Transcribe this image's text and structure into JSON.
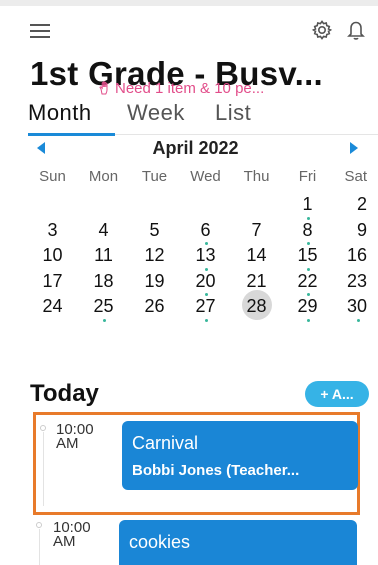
{
  "header": {
    "menu_icon": "hamburger-icon",
    "settings_icon": "gear-icon",
    "notifications_icon": "bell-icon",
    "title": "1st Grade - Busv..."
  },
  "tabs": [
    {
      "label": "Month",
      "active": true
    },
    {
      "label": "Week",
      "active": false
    },
    {
      "label": "List",
      "active": false
    }
  ],
  "calendar": {
    "month_label": "April 2022",
    "weekdays": [
      "Sun",
      "Mon",
      "Tue",
      "Wed",
      "Thu",
      "Fri",
      "Sat"
    ],
    "weeks": [
      [
        {
          "d": "",
          "dot": false
        },
        {
          "d": "",
          "dot": false
        },
        {
          "d": "",
          "dot": false
        },
        {
          "d": "",
          "dot": false
        },
        {
          "d": "",
          "dot": false
        },
        {
          "d": "1",
          "dot": true
        },
        {
          "d": "2",
          "dot": false
        }
      ],
      [
        {
          "d": "3",
          "dot": false
        },
        {
          "d": "4",
          "dot": false
        },
        {
          "d": "5",
          "dot": false
        },
        {
          "d": "6",
          "dot": true
        },
        {
          "d": "7",
          "dot": false
        },
        {
          "d": "8",
          "dot": true
        },
        {
          "d": "9",
          "dot": false
        }
      ],
      [
        {
          "d": "10",
          "dot": false
        },
        {
          "d": "11",
          "dot": false
        },
        {
          "d": "12",
          "dot": false
        },
        {
          "d": "13",
          "dot": true
        },
        {
          "d": "14",
          "dot": false
        },
        {
          "d": "15",
          "dot": true
        },
        {
          "d": "16",
          "dot": false
        }
      ],
      [
        {
          "d": "17",
          "dot": false
        },
        {
          "d": "18",
          "dot": false
        },
        {
          "d": "19",
          "dot": false
        },
        {
          "d": "20",
          "dot": true
        },
        {
          "d": "21",
          "dot": false
        },
        {
          "d": "22",
          "dot": true
        },
        {
          "d": "23",
          "dot": false
        }
      ],
      [
        {
          "d": "24",
          "dot": false
        },
        {
          "d": "25",
          "dot": true
        },
        {
          "d": "26",
          "dot": false
        },
        {
          "d": "27",
          "dot": true
        },
        {
          "d": "28",
          "dot": false,
          "selected": true
        },
        {
          "d": "29",
          "dot": true
        },
        {
          "d": "30",
          "dot": true
        }
      ]
    ]
  },
  "today": {
    "label": "Today",
    "add_button_label": "+ A...",
    "events": [
      {
        "time_line1": "10:00",
        "time_line2": "AM",
        "title": "Carnival",
        "subtitle": "Bobbi Jones (Teacher...",
        "need_text": "Need 1 item & 10 pe...",
        "need_icon": "hand-icon"
      },
      {
        "time_line1": "10:00",
        "time_line2": "AM",
        "title": "cookies"
      }
    ]
  },
  "colors": {
    "accent": "#1a8ad8",
    "event_card": "#1a86d6",
    "add_button": "#36b3e6",
    "highlight_border": "#e87a2a",
    "need_text": "#e24d8a",
    "event_dot": "#39b79c",
    "selected_day": "#d8d8d8"
  }
}
